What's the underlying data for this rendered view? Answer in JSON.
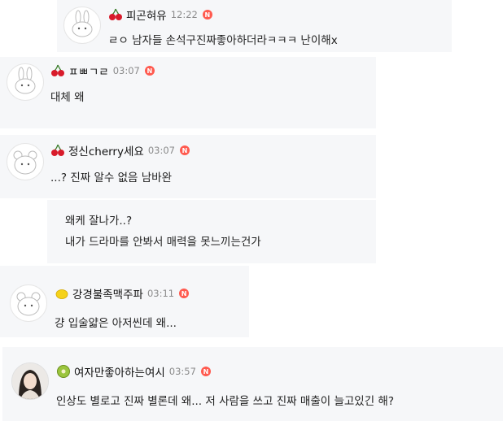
{
  "comments": [
    {
      "nickname": "피곤혀유",
      "time": "12:22",
      "badge": "N",
      "emoji": "cherry-icon",
      "lines": [
        "ㄹㅇ 남자들 손석구진짜좋아하더라ㅋㅋㅋ 난이해x"
      ]
    },
    {
      "nickname": "ㅍㅃㄱㄹ",
      "time": "03:07",
      "badge": "N",
      "emoji": "cherry-icon",
      "lines": [
        "대체 왜"
      ]
    },
    {
      "nickname": "정신cherry세요",
      "time": "03:07",
      "badge": "N",
      "emoji": "cherry-icon",
      "lines": [
        "...? 진짜 알수 없음 남바완"
      ]
    },
    {
      "nickname": "",
      "time": "",
      "badge": "",
      "emoji": "",
      "lines": [
        "왜케 잘나가..?",
        "내가 드라마를 안봐서 매력을 못느끼는건가"
      ]
    },
    {
      "nickname": "강경불족맥주파",
      "time": "03:11",
      "badge": "N",
      "emoji": "lemon-icon",
      "lines": [
        "걍 입술얇은 아저씬데 왜..."
      ]
    },
    {
      "nickname": "여자만좋아하는여시",
      "time": "03:57",
      "badge": "N",
      "emoji": "kiwi-icon",
      "lines": [
        "인상도 별로고 진짜 별론데 왜... 저 사람을 쓰고 진짜 매출이 늘고있긴 해?"
      ]
    }
  ],
  "colors": {
    "card_bg": "#f6f7f9",
    "badge": "#ff5a4f",
    "time": "#8a8a8a"
  }
}
